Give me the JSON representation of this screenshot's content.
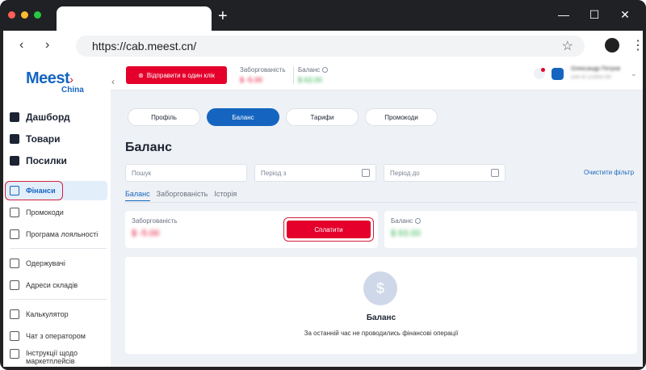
{
  "browser": {
    "url": "https://cab.meest.cn/",
    "new_tab_glyph": "+",
    "back_glyph": "‹",
    "forward_glyph": "›",
    "star_glyph": "☆",
    "kebab_glyph": "⋮",
    "minimize_glyph": "—",
    "maximize_glyph": "☐",
    "close_glyph": "✕",
    "dot_colors": [
      "#ff5f57",
      "#febc2e",
      "#28c840"
    ]
  },
  "sidebar": {
    "logo_main": "Meest",
    "logo_sub": "China",
    "collapse_glyph": "‹",
    "items_main": [
      {
        "label": "Дашборд",
        "icon": "dashboard-icon"
      },
      {
        "label": "Товари",
        "icon": "cart-icon"
      },
      {
        "label": "Посилки",
        "icon": "parcel-icon"
      }
    ],
    "items_finance": [
      {
        "label": "Фінанси",
        "icon": "wallet-icon",
        "active": true
      },
      {
        "label": "Промокоди",
        "icon": "percent-icon"
      },
      {
        "label": "Програма лояльності",
        "icon": "loyalty-icon"
      }
    ],
    "items_people": [
      {
        "label": "Одержувачі",
        "icon": "recipients-icon"
      },
      {
        "label": "Адреси складів",
        "icon": "location-icon"
      }
    ],
    "items_tools": [
      {
        "label": "Калькулятор",
        "icon": "calculator-icon"
      },
      {
        "label": "Чат з оператором",
        "icon": "chat-icon"
      },
      {
        "label": "Інструкції щодо маркетплейсів",
        "icon": "book-icon"
      }
    ]
  },
  "header": {
    "send_button": "Відправити в один клік",
    "debt_label": "Заборгованість",
    "debt_value": "$ -5.00",
    "balance_label": "Баланс",
    "balance_value": "$ 63.00",
    "user_name": "Олександр Петров",
    "user_sub": "user id 123456789",
    "chevron": "⌄"
  },
  "tabs": [
    "Профіль",
    "Баланс",
    "Тарифи",
    "Промокоди"
  ],
  "active_tab": "Баланс",
  "page_title": "Баланс",
  "filters": {
    "search_placeholder": "Пошук",
    "from_placeholder": "Період з",
    "to_placeholder": "Період до",
    "clear_label": "Очистити фільтр"
  },
  "subtabs": [
    "Баланс",
    "Заборгованість",
    "Історія"
  ],
  "debt_card": {
    "label": "Заборгованість",
    "value": "$ -5.00",
    "pay_button": "Сплатити"
  },
  "balance_card": {
    "label": "Баланс",
    "value": "$ 63.00"
  },
  "empty_state": {
    "symbol": "$",
    "title": "Баланс",
    "text": "За останній час не проводились фінансові операції"
  },
  "colors": {
    "brand_blue": "#1565c0",
    "brand_red": "#e4002b",
    "success": "#2bb04a"
  }
}
